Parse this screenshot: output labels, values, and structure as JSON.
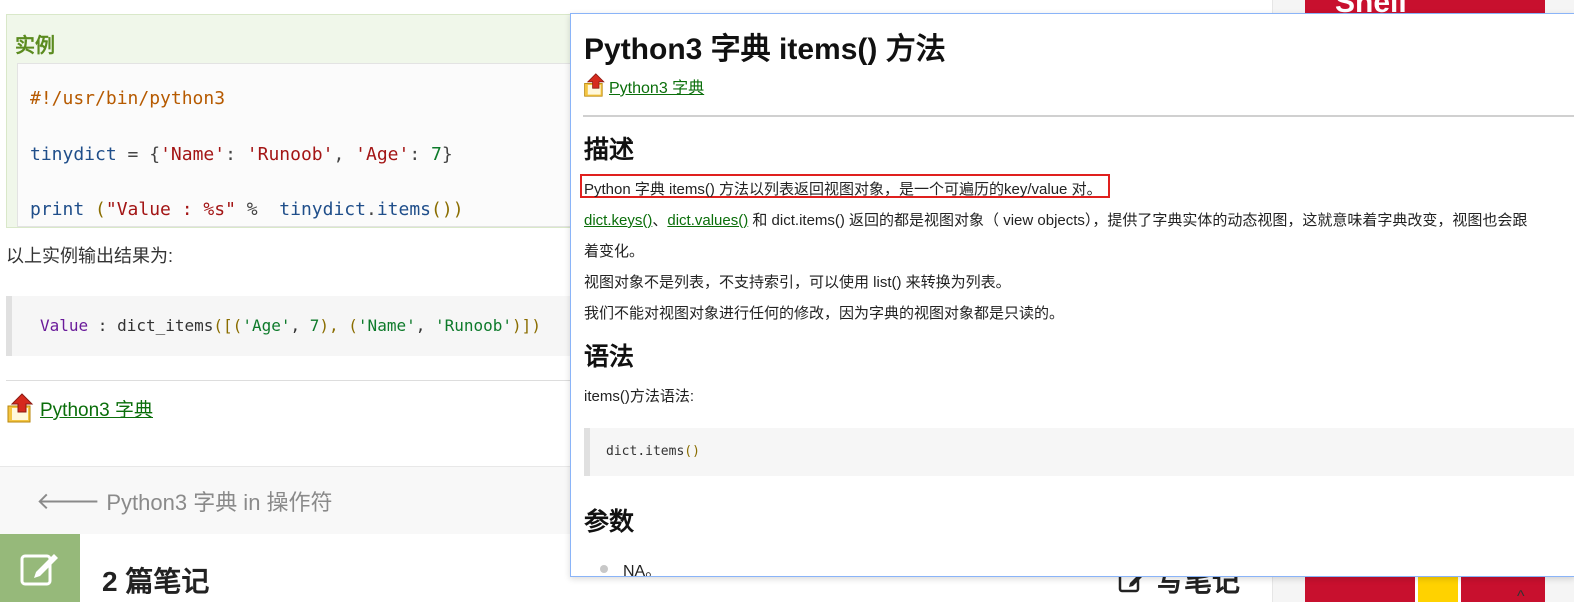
{
  "page": {
    "example_title": "实例",
    "code_lines": {
      "shebang": "#!/usr/bin/python3",
      "line2_var": "tinydict",
      "line2_eq": " = {",
      "line2_k1": "'Name'",
      "line2_c1": ": ",
      "line2_v1": "'Runoob'",
      "line2_sep": ", ",
      "line2_k2": "'Age'",
      "line2_c2": ": ",
      "line2_v2": "7",
      "line2_end": "}",
      "line3_kw": "print",
      "line3_sp": " ",
      "line3_open": "(",
      "line3_str": "\"Value : %s\"",
      "line3_op": " %  ",
      "line3_obj": "tinydict",
      "line3_dot": ".",
      "line3_fn": "items",
      "line3_close": "())"
    },
    "result_label": "以上实例输出结果为:",
    "result": {
      "a": "Value",
      "b": " : dict_items",
      "c": "([(",
      "d": "'Age'",
      "e": ", ",
      "f": "7",
      "g": "), (",
      "h": "'Name'",
      "i": ", ",
      "j": "'Runoob'",
      "k": ")])"
    },
    "dict_link": "Python3 字典",
    "prev_link": "Python3 字典 in 操作符",
    "notes_title": "2 篇笔记",
    "write_note": "写笔记",
    "ad_top_text": "Shell"
  },
  "popup": {
    "title": "Python3 字典 items() 方法",
    "dict_link": "Python3 字典",
    "h_desc": "描述",
    "desc1": "Python 字典 items() 方法以列表返回视图对象，是一个可遍历的key/value 对。",
    "desc2_link1": "dict.keys()",
    "desc2_sep": "、",
    "desc2_link2": "dict.values()",
    "desc2_rest": " 和 dict.items() 返回的都是视图对象（ view objects），提供了字典实体的动态视图，这就意味着字典改变，视图也会跟",
    "desc3": "着变化。",
    "desc4": "视图对象不是列表，不支持索引，可以使用 list() 来转换为列表。",
    "desc5": "我们不能对视图对象进行任何的修改，因为字典的视图对象都是只读的。",
    "h_syntax": "语法",
    "syntax_intro": "items()方法语法:",
    "syntax_code_a": "dict",
    "syntax_code_b": ".",
    "syntax_code_c": "items",
    "syntax_code_d": "()",
    "h_params": "参数",
    "param_na": "NA。"
  },
  "colors": {
    "accent_green": "#0a6e0a",
    "highlight_red": "#e0201e",
    "popup_border": "#8ab4f8"
  }
}
